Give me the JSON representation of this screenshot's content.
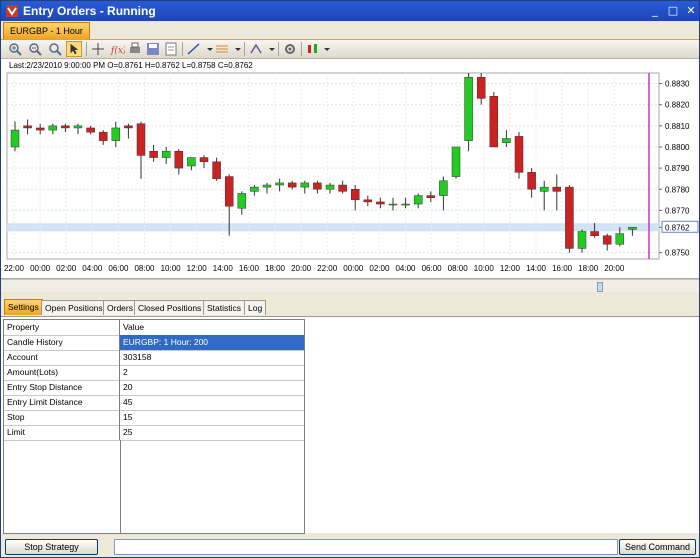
{
  "window": {
    "title": "Entry Orders - Running",
    "minimize": "_",
    "maximize": "□",
    "close": "✕"
  },
  "chart_tab": {
    "label": "EURGBP - 1 Hour"
  },
  "toolbar": {
    "icons": [
      "zoom-in-icon",
      "zoom-out-icon",
      "zoom-fit-icon",
      "cursor-icon",
      "crosshair-icon",
      "fx-icon",
      "print-icon",
      "save-icon",
      "export-icon",
      "line-tool-icon",
      "fibonacci-icon",
      "drawing-tools-icon",
      "properties-icon",
      "indicators-icon"
    ]
  },
  "chart_info": "Last:2/23/2010 9:00:00 PM O=0.8761 H=0.8762 L=0.8758 C=0.8762",
  "chart_data": {
    "type": "candlestick",
    "x": [
      "22:00",
      "00:00",
      "02:00",
      "04:00",
      "06:00",
      "08:00",
      "10:00",
      "12:00",
      "14:00",
      "16:00",
      "18:00",
      "20:00",
      "22:00",
      "00:00",
      "02:00",
      "04:00",
      "06:00",
      "08:00",
      "10:00",
      "12:00",
      "14:00",
      "16:00",
      "18:00",
      "20:00"
    ],
    "y_ticks": [
      "0.8830",
      "0.8820",
      "0.8810",
      "0.8800",
      "0.8790",
      "0.8780",
      "0.8770",
      "0.8762",
      "0.8750"
    ],
    "ylim": [
      0.8747,
      0.8835
    ],
    "current_price": 0.8762,
    "candles": [
      {
        "o": 0.88,
        "h": 0.8812,
        "l": 0.8798,
        "c": 0.8808
      },
      {
        "o": 0.881,
        "h": 0.8813,
        "l": 0.8806,
        "c": 0.8809
      },
      {
        "o": 0.8809,
        "h": 0.8811,
        "l": 0.8806,
        "c": 0.8808
      },
      {
        "o": 0.8808,
        "h": 0.8811,
        "l": 0.8806,
        "c": 0.881
      },
      {
        "o": 0.881,
        "h": 0.8811,
        "l": 0.8807,
        "c": 0.8809
      },
      {
        "o": 0.8809,
        "h": 0.8811,
        "l": 0.8806,
        "c": 0.881
      },
      {
        "o": 0.8809,
        "h": 0.881,
        "l": 0.8806,
        "c": 0.8807
      },
      {
        "o": 0.8807,
        "h": 0.8808,
        "l": 0.8801,
        "c": 0.8803
      },
      {
        "o": 0.8803,
        "h": 0.8812,
        "l": 0.88,
        "c": 0.8809
      },
      {
        "o": 0.881,
        "h": 0.8811,
        "l": 0.8804,
        "c": 0.8809
      },
      {
        "o": 0.8811,
        "h": 0.8812,
        "l": 0.8785,
        "c": 0.8796
      },
      {
        "o": 0.8798,
        "h": 0.8801,
        "l": 0.8793,
        "c": 0.8795
      },
      {
        "o": 0.8795,
        "h": 0.88,
        "l": 0.8792,
        "c": 0.8798
      },
      {
        "o": 0.8798,
        "h": 0.8799,
        "l": 0.8787,
        "c": 0.879
      },
      {
        "o": 0.8791,
        "h": 0.8795,
        "l": 0.8789,
        "c": 0.8795
      },
      {
        "o": 0.8795,
        "h": 0.8796,
        "l": 0.879,
        "c": 0.8793
      },
      {
        "o": 0.8793,
        "h": 0.8795,
        "l": 0.8784,
        "c": 0.8785
      },
      {
        "o": 0.8786,
        "h": 0.8787,
        "l": 0.8758,
        "c": 0.8772
      },
      {
        "o": 0.8771,
        "h": 0.8779,
        "l": 0.8768,
        "c": 0.8778
      },
      {
        "o": 0.8779,
        "h": 0.8782,
        "l": 0.8777,
        "c": 0.8781
      },
      {
        "o": 0.8781,
        "h": 0.8783,
        "l": 0.8778,
        "c": 0.8782
      },
      {
        "o": 0.8782,
        "h": 0.8785,
        "l": 0.8779,
        "c": 0.8783
      },
      {
        "o": 0.8783,
        "h": 0.8784,
        "l": 0.878,
        "c": 0.8781
      },
      {
        "o": 0.8781,
        "h": 0.8784,
        "l": 0.8778,
        "c": 0.8783
      },
      {
        "o": 0.8783,
        "h": 0.8784,
        "l": 0.8778,
        "c": 0.878
      },
      {
        "o": 0.878,
        "h": 0.8783,
        "l": 0.8778,
        "c": 0.8782
      },
      {
        "o": 0.8782,
        "h": 0.8784,
        "l": 0.8778,
        "c": 0.8779
      },
      {
        "o": 0.878,
        "h": 0.8782,
        "l": 0.877,
        "c": 0.8775
      },
      {
        "o": 0.8775,
        "h": 0.8777,
        "l": 0.8772,
        "c": 0.8774
      },
      {
        "o": 0.8774,
        "h": 0.8776,
        "l": 0.8771,
        "c": 0.8773
      },
      {
        "o": 0.8773,
        "h": 0.8776,
        "l": 0.877,
        "c": 0.8773
      },
      {
        "o": 0.8773,
        "h": 0.8776,
        "l": 0.8771,
        "c": 0.8773
      },
      {
        "o": 0.8773,
        "h": 0.8778,
        "l": 0.8771,
        "c": 0.8777
      },
      {
        "o": 0.8777,
        "h": 0.8779,
        "l": 0.8774,
        "c": 0.8776
      },
      {
        "o": 0.8777,
        "h": 0.8786,
        "l": 0.877,
        "c": 0.8784
      },
      {
        "o": 0.8786,
        "h": 0.88,
        "l": 0.8785,
        "c": 0.88
      },
      {
        "o": 0.8803,
        "h": 0.8835,
        "l": 0.8798,
        "c": 0.8833
      },
      {
        "o": 0.8833,
        "h": 0.8835,
        "l": 0.882,
        "c": 0.8823
      },
      {
        "o": 0.8824,
        "h": 0.8826,
        "l": 0.8804,
        "c": 0.88
      },
      {
        "o": 0.8802,
        "h": 0.8808,
        "l": 0.88,
        "c": 0.8804
      },
      {
        "o": 0.8805,
        "h": 0.8807,
        "l": 0.8785,
        "c": 0.8788
      },
      {
        "o": 0.8788,
        "h": 0.879,
        "l": 0.8776,
        "c": 0.878
      },
      {
        "o": 0.8779,
        "h": 0.8784,
        "l": 0.877,
        "c": 0.8781
      },
      {
        "o": 0.8781,
        "h": 0.8787,
        "l": 0.877,
        "c": 0.8779
      },
      {
        "o": 0.8781,
        "h": 0.8782,
        "l": 0.875,
        "c": 0.8752
      },
      {
        "o": 0.8752,
        "h": 0.8761,
        "l": 0.875,
        "c": 0.876
      },
      {
        "o": 0.876,
        "h": 0.8764,
        "l": 0.8757,
        "c": 0.8758
      },
      {
        "o": 0.8758,
        "h": 0.8759,
        "l": 0.8751,
        "c": 0.8754
      },
      {
        "o": 0.8754,
        "h": 0.8762,
        "l": 0.8753,
        "c": 0.8759
      },
      {
        "o": 0.8761,
        "h": 0.8762,
        "l": 0.8758,
        "c": 0.8762
      }
    ]
  },
  "bottom_tabs": [
    "Settings",
    "Open Positions",
    "Orders",
    "Closed Positions",
    "Statistics",
    "Log"
  ],
  "settings_table": {
    "headers": [
      "Property",
      "Value"
    ],
    "rows": [
      {
        "property": "Candle History",
        "value": "EURGBP: 1 Hour: 200"
      },
      {
        "property": "Account",
        "value": "303158"
      },
      {
        "property": "Amount(Lots)",
        "value": "2"
      },
      {
        "property": "Entry Stop Distance",
        "value": "20"
      },
      {
        "property": "Entry Limit Distance",
        "value": "45"
      },
      {
        "property": "Stop",
        "value": "15"
      },
      {
        "property": "Limit",
        "value": "25"
      }
    ]
  },
  "bottom_bar": {
    "stop_label": "Stop Strategy",
    "command_value": "",
    "send_label": "Send Command"
  },
  "colors": {
    "up": "#22cc22",
    "down": "#cc2222",
    "title": "#1c47b8",
    "tab_active": "#f2a224",
    "selection": "#316ac5",
    "cursor_line": "#cc33cc",
    "price_band": "#cfe2f6"
  }
}
